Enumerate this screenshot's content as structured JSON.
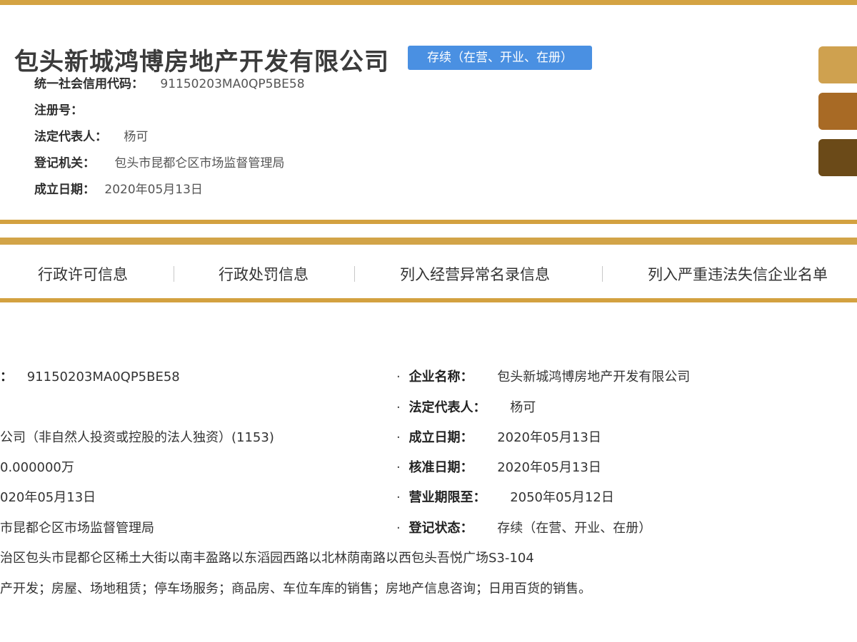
{
  "company": {
    "name": "包头新城鸿博房地产开发有限公司",
    "status_badge": "存续（在营、开业、在册）"
  },
  "header_info": [
    {
      "label": "统一社会信用代码：",
      "value": "91150203MA0QP5BE58"
    },
    {
      "label": "注册号：",
      "value": ""
    },
    {
      "label": "法定代表人：",
      "value": "杨可"
    },
    {
      "label": "登记机关：",
      "value": "包头市昆都仑区市场监督管理局"
    },
    {
      "label": "成立日期：",
      "value": "2020年05月13日"
    }
  ],
  "nav_tabs": [
    "行政许可信息",
    "行政处罚信息",
    "列入经营异常名录信息",
    "列入严重违法失信企业名单"
  ],
  "details_left": [
    {
      "label": "：",
      "value": "91150203MA0QP5BE58"
    },
    {
      "label": "",
      "value": "公司（非自然人投资或控股的法人独资）(1153)"
    },
    {
      "label": "",
      "value": "0.000000万"
    },
    {
      "label": "",
      "value": "020年05月13日"
    },
    {
      "label": "",
      "value": "市昆都仑区市场监督管理局"
    },
    {
      "label": "",
      "value": "治区包头市昆都仑区稀土大街以南丰盈路以东滔园西路以北林荫南路以西包头吾悦广场S3-104"
    },
    {
      "label": "",
      "value": "产开发；房屋、场地租赁；停车场服务；商品房、车位车库的销售；房地产信息咨询；日用百货的销售。"
    }
  ],
  "details_right": [
    {
      "label": "企业名称：",
      "value": "包头新城鸿博房地产开发有限公司"
    },
    {
      "label": "法定代表人：",
      "value": "杨可"
    },
    {
      "label": "成立日期：",
      "value": "2020年05月13日"
    },
    {
      "label": "核准日期：",
      "value": "2020年05月13日"
    },
    {
      "label": "营业期限至：",
      "value": "2050年05月12日"
    },
    {
      "label": "登记状态：",
      "value": "存续（在营、开业、在册）"
    }
  ],
  "colors": {
    "gold": "#d4a343",
    "badge_blue": "#4a90e2",
    "side_btn_1": "#cfa14f",
    "side_btn_2": "#a86a25",
    "side_btn_3": "#6b4a18"
  }
}
